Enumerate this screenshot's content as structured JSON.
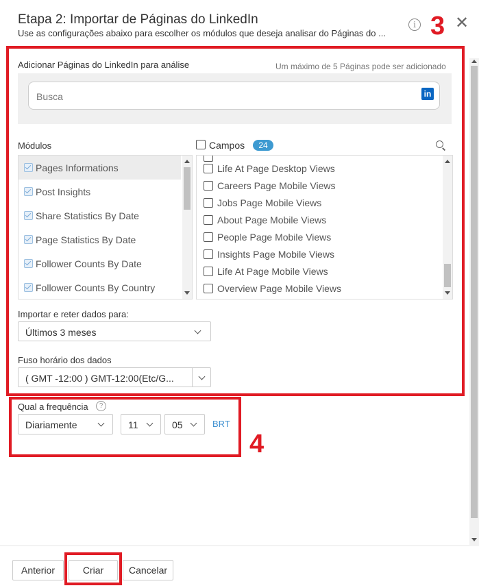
{
  "dialog": {
    "title": "Etapa 2: Importar de Páginas do LinkedIn",
    "subtitle": "Use as configurações abaixo para escolher os módulos que deseja analisar do Páginas do ..."
  },
  "annotations": {
    "box3_number": "3",
    "box4_number": "4",
    "color": "#e01b24"
  },
  "pages_section": {
    "label": "Adicionar Páginas do LinkedIn para análise",
    "limit_note": "Um máximo de 5 Páginas pode ser adicionado",
    "search_placeholder": "Busca",
    "linkedin_icon_text": "in"
  },
  "modules": {
    "label": "Módulos",
    "items": [
      {
        "label": "Pages Informations",
        "checked": true,
        "selected": true
      },
      {
        "label": "Post Insights",
        "checked": true
      },
      {
        "label": "Share Statistics By Date",
        "checked": true
      },
      {
        "label": "Page Statistics By Date",
        "checked": true
      },
      {
        "label": "Follower Counts By Date",
        "checked": true
      },
      {
        "label": "Follower Counts By Country",
        "checked": true
      }
    ]
  },
  "fields": {
    "label": "Campos",
    "count": "24",
    "items": [
      {
        "label": "Life At Page Desktop Views",
        "checked": false
      },
      {
        "label": "Careers Page Mobile Views",
        "checked": false
      },
      {
        "label": "Jobs Page Mobile Views",
        "checked": false
      },
      {
        "label": "About Page Mobile Views",
        "checked": false
      },
      {
        "label": "People Page Mobile Views",
        "checked": false
      },
      {
        "label": "Insights Page Mobile Views",
        "checked": false
      },
      {
        "label": "Life At Page Mobile Views",
        "checked": false
      },
      {
        "label": "Overview Page Mobile Views",
        "checked": false
      }
    ]
  },
  "import": {
    "label": "Importar e reter dados para:",
    "value": "Últimos 3 meses"
  },
  "timezone": {
    "label": "Fuso horário dos dados",
    "value": "( GMT -12:00 ) GMT-12:00(Etc/G..."
  },
  "frequency": {
    "label": "Qual a frequência",
    "help_icon": "?",
    "value": "Diariamente",
    "hour": "11",
    "minute": "05",
    "tz_label": "BRT"
  },
  "footer": {
    "previous": "Anterior",
    "create": "Criar",
    "cancel": "Cancelar"
  }
}
